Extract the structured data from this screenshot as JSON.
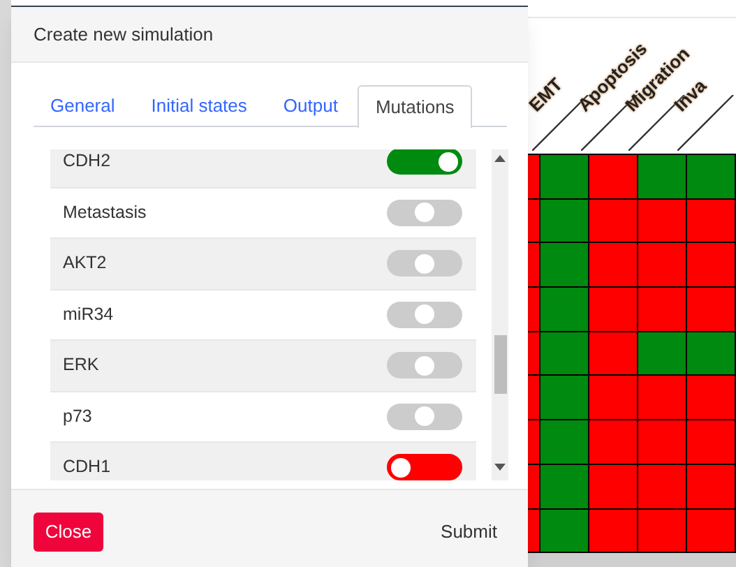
{
  "dialog": {
    "title": "Create new simulation",
    "tabs": [
      {
        "label": "General",
        "selected": false
      },
      {
        "label": "Initial states",
        "selected": false
      },
      {
        "label": "Output",
        "selected": false
      },
      {
        "label": "Mutations",
        "selected": true
      }
    ],
    "mutations": [
      {
        "name": "CDH2",
        "on": true,
        "off": false
      },
      {
        "name": "Metastasis",
        "on": false,
        "off": false
      },
      {
        "name": "AKT2",
        "on": false,
        "off": false
      },
      {
        "name": "miR34",
        "on": false,
        "off": false
      },
      {
        "name": "ERK",
        "on": false,
        "off": false
      },
      {
        "name": "p73",
        "on": false,
        "off": false
      },
      {
        "name": "CDH1",
        "on": false,
        "off": true
      }
    ],
    "buttons": {
      "close": "Close",
      "submit": "Submit"
    }
  },
  "heatmap": {
    "columns": [
      "EMT",
      "Apoptosis",
      "Migration",
      "Inva"
    ],
    "rows": [
      {
        "cells": [
          false,
          true,
          false,
          true,
          true
        ]
      },
      {
        "cells": [
          false,
          true,
          false,
          false,
          false
        ]
      },
      {
        "cells": [
          false,
          true,
          false,
          false,
          false
        ]
      },
      {
        "cells": [
          false,
          true,
          false,
          false,
          false
        ]
      },
      {
        "cells": [
          false,
          true,
          false,
          true,
          true
        ]
      },
      {
        "cells": [
          false,
          true,
          false,
          false,
          false
        ]
      },
      {
        "cells": [
          false,
          true,
          false,
          false,
          false
        ]
      },
      {
        "cells": [
          false,
          true,
          false,
          false,
          false
        ]
      },
      {
        "cells": [
          false,
          true,
          false,
          false,
          false
        ]
      }
    ]
  }
}
